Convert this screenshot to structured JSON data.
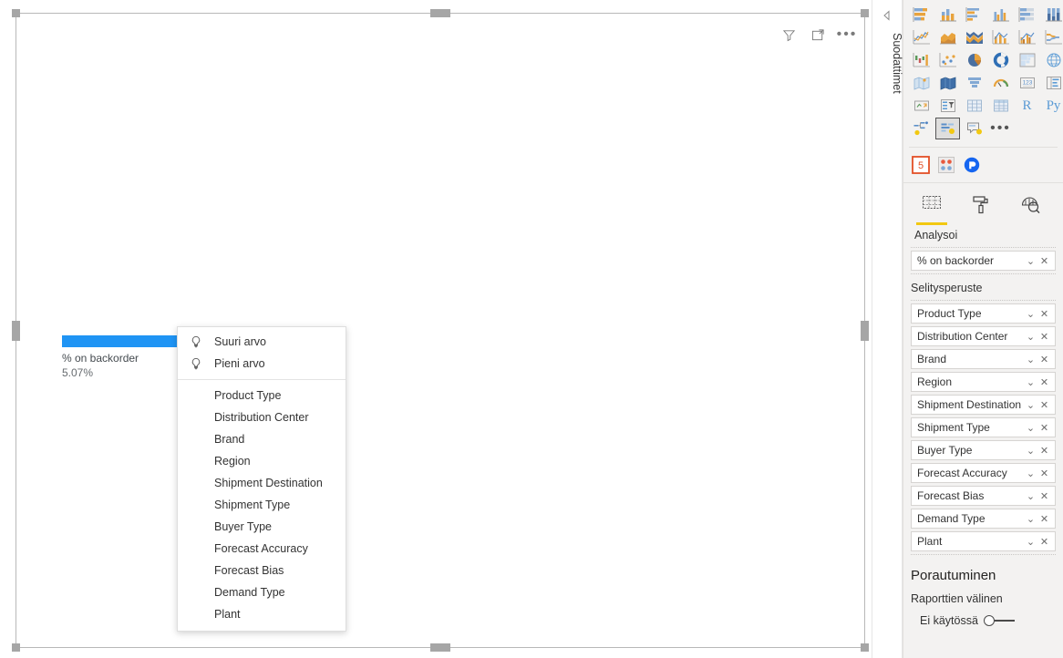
{
  "canvas": {
    "visual_header_icons": [
      {
        "name": "filter-icon",
        "label": "Suodattimet"
      },
      {
        "name": "focus-mode-icon",
        "label": "Tarkennustila"
      },
      {
        "name": "more-options-icon",
        "label": "Lisää asetuksia"
      }
    ]
  },
  "chart_data": {
    "type": "bar",
    "title": "",
    "categories": [
      "% on backorder"
    ],
    "values": [
      5.07
    ],
    "value_labels": [
      "5.07%"
    ],
    "series": [
      {
        "name": "% on backorder",
        "values": [
          5.07
        ]
      }
    ],
    "xlabel": "",
    "ylabel": "",
    "ylim": [
      0,
      5.07
    ],
    "bar_color": "#1f94f4",
    "label_name": "% on backorder",
    "label_value": "5.07%",
    "grid": false,
    "legend": "none"
  },
  "context_menu": {
    "items": [
      {
        "label": "Suuri arvo",
        "icon": "lightbulb-icon"
      },
      {
        "label": "Pieni arvo",
        "icon": "lightbulb-icon"
      }
    ],
    "fields": [
      {
        "label": "Product Type"
      },
      {
        "label": "Distribution Center"
      },
      {
        "label": "Brand"
      },
      {
        "label": "Region"
      },
      {
        "label": "Shipment Destination"
      },
      {
        "label": "Shipment Type"
      },
      {
        "label": "Buyer Type"
      },
      {
        "label": "Forecast Accuracy"
      },
      {
        "label": "Forecast Bias"
      },
      {
        "label": "Demand Type"
      },
      {
        "label": "Plant"
      }
    ]
  },
  "filters_pane": {
    "title": "Suodattimet",
    "expand_icon": "expand-left-icon"
  },
  "right_pane": {
    "gallery": {
      "icons": [
        "stacked-bar-chart-icon",
        "stacked-column-chart-icon",
        "clustered-bar-chart-icon",
        "clustered-column-chart-icon",
        "hundred-percent-stacked-bar-chart-icon",
        "hundred-percent-stacked-column-chart-icon",
        "line-chart-icon",
        "area-chart-icon",
        "stacked-area-chart-icon",
        "line-stacked-column-chart-icon",
        "line-clustered-column-chart-icon",
        "ribbon-chart-icon",
        "waterfall-chart-icon",
        "scatter-chart-icon",
        "pie-chart-icon",
        "donut-chart-icon",
        "treemap-icon",
        "map-icon",
        "filled-map-icon",
        "shape-map-icon",
        "funnel-chart-icon",
        "gauge-chart-icon",
        "card-icon",
        "multi-row-card-icon",
        "kpi-icon",
        "slicer-icon",
        "table-icon",
        "matrix-icon",
        "r-script-visual-icon",
        "python-visual-icon",
        "decomposition-tree-icon",
        "key-influencers-icon",
        "qna-icon",
        "more-visuals-icon"
      ],
      "selected_index": 31,
      "r_label": "R",
      "py_label": "Py"
    },
    "custom_visuals": [
      "html-content-icon",
      "custom-visual-icon",
      "power-bi-visual-icon"
    ],
    "tabs": [
      {
        "name": "fields-tab",
        "icon": "fields-table-icon",
        "active": true
      },
      {
        "name": "format-tab",
        "icon": "paint-roller-icon",
        "active": false
      },
      {
        "name": "analytics-tab",
        "icon": "analytics-magnifier-icon",
        "active": false
      }
    ],
    "tab_label": "Analysoi",
    "analyze_field": {
      "name": "% on backorder",
      "chevron": "⌄",
      "remove": "✕"
    },
    "explain_by_header": "Selitysperuste",
    "explain_by_fields": [
      {
        "name": "Product Type"
      },
      {
        "name": "Distribution Center"
      },
      {
        "name": "Brand"
      },
      {
        "name": "Region"
      },
      {
        "name": "Shipment Destination"
      },
      {
        "name": "Shipment Type"
      },
      {
        "name": "Buyer Type"
      },
      {
        "name": "Forecast Accuracy"
      },
      {
        "name": "Forecast Bias"
      },
      {
        "name": "Demand Type"
      },
      {
        "name": "Plant"
      }
    ],
    "chevron_glyph": "⌄",
    "remove_glyph": "✕",
    "drillthrough": {
      "title": "Porautuminen",
      "subtitle": "Raporttien välinen",
      "toggle_label": "Ei käytössä",
      "toggle_on": false
    }
  },
  "colors": {
    "accent_bar": "#1f94f4",
    "pane_bg": "#f3f2f1",
    "tab_underline": "#f2c811"
  }
}
